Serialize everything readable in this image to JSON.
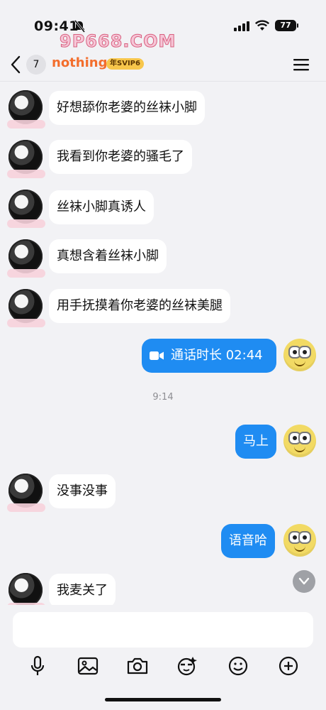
{
  "status": {
    "time": "09:41",
    "battery": "77",
    "watermark": "9P668.COM"
  },
  "header": {
    "back_badge": "7",
    "title": "nothing",
    "vip_label": "年SVIP6"
  },
  "messages": [
    {
      "side": "left",
      "text": "好想舔你老婆的丝袜小脚"
    },
    {
      "side": "left",
      "text": "我看到你老婆的骚毛了"
    },
    {
      "side": "left",
      "text": "丝袜小脚真诱人"
    },
    {
      "side": "left",
      "text": "真想含着丝袜小脚"
    },
    {
      "side": "left",
      "text": "用手抚摸着你老婆的丝袜美腿"
    },
    {
      "side": "right",
      "text": "通话时长 02:44"
    },
    {
      "side": "left",
      "text": "没事没事"
    },
    {
      "side": "right",
      "text": "马上"
    },
    {
      "side": "right",
      "text": "语音哈"
    },
    {
      "side": "left",
      "text": "我麦关了"
    }
  ],
  "timestamp": "9:14",
  "toolbar": {
    "icons": [
      "microphone-icon",
      "image-icon",
      "camera-icon",
      "sticker-icon",
      "emoji-icon",
      "plus-icon"
    ]
  },
  "colors": {
    "accent": "#1f8cf2",
    "title": "#f36e2d",
    "background": "#f2f2f5"
  }
}
